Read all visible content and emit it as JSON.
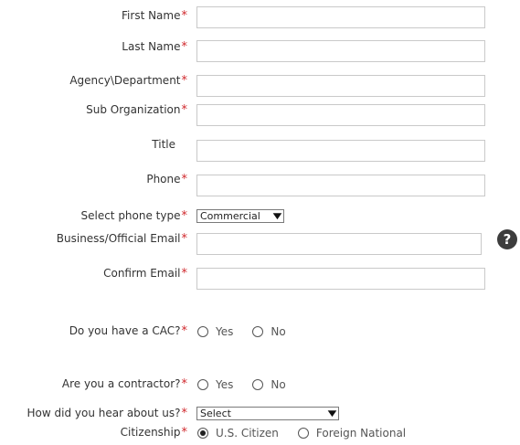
{
  "form": {
    "required_marker": "*",
    "first_name": {
      "label": "First Name",
      "value": ""
    },
    "last_name": {
      "label": "Last Name",
      "value": ""
    },
    "agency": {
      "label": "Agency\\Department",
      "value": ""
    },
    "sub_org": {
      "label": "Sub Organization",
      "value": ""
    },
    "title": {
      "label": "Title",
      "value": ""
    },
    "phone": {
      "label": "Phone",
      "value": ""
    },
    "phone_type": {
      "label": "Select phone type",
      "selected": "Commercial"
    },
    "email": {
      "label": "Business/Official Email",
      "value": ""
    },
    "confirm_email": {
      "label": "Confirm Email",
      "value": ""
    },
    "cac": {
      "label": "Do you have a CAC?",
      "yes": "Yes",
      "no": "No",
      "selected": ""
    },
    "contractor": {
      "label": "Are you a contractor?",
      "yes": "Yes",
      "no": "No",
      "selected": ""
    },
    "heard": {
      "label": "How did you hear about us?",
      "selected": "Select"
    },
    "citizenship": {
      "label": "Citizenship",
      "us": "U.S. Citizen",
      "foreign": "Foreign National",
      "selected": "U.S. Citizen"
    }
  },
  "icons": {
    "help": "question-mark-circle-icon",
    "help_glyph": "?",
    "dropdown": "chevron-down-icon",
    "dropdown_glyph": "▼"
  },
  "colors": {
    "required": "#d0282c",
    "help_bg": "#3d3d3d"
  }
}
